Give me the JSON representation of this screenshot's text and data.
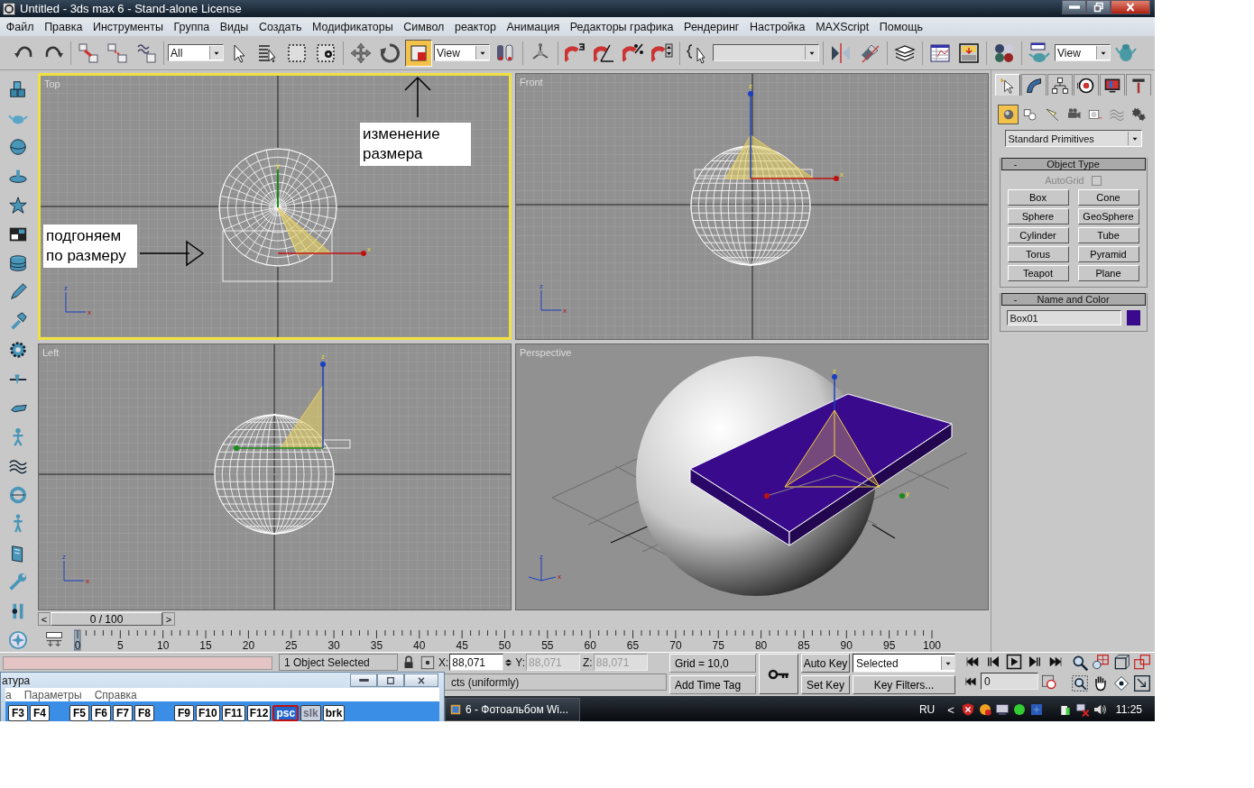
{
  "window": {
    "title": "Untitled - 3ds max 6 - Stand-alone License"
  },
  "menu": [
    "Файл",
    "Правка",
    "Инструменты",
    "Группа",
    "Виды",
    "Создать",
    "Модификаторы",
    "Символ",
    "реактор",
    "Анимация",
    "Редакторы графика",
    "Рендеринг",
    "Настройка",
    "MAXScript",
    "Помощь"
  ],
  "toolbar": [
    [
      {
        "kind": "button",
        "selected": false
      },
      {
        "kind": "button",
        "selected": false
      }
    ],
    [
      {
        "kind": "button",
        "selected": false
      },
      {
        "kind": "button",
        "selected": false
      },
      {
        "kind": "button",
        "selected": false
      }
    ],
    [
      {
        "kind": "dropdown",
        "value": "All"
      },
      {
        "kind": "button",
        "selected": false
      },
      {
        "kind": "button",
        "selected": false
      },
      {
        "kind": "button",
        "selected": false
      },
      {
        "kind": "button",
        "selected": false
      }
    ],
    [
      {
        "kind": "button",
        "selected": false
      },
      {
        "kind": "button",
        "selected": false
      },
      {
        "kind": "button",
        "selected": true
      },
      {
        "kind": "dropdown",
        "value": "View"
      },
      {
        "kind": "button",
        "selected": false
      }
    ],
    [
      {
        "kind": "button",
        "selected": false
      }
    ],
    [
      {
        "kind": "button",
        "selected": false
      },
      {
        "kind": "button",
        "selected": false
      },
      {
        "kind": "button",
        "selected": false
      },
      {
        "kind": "button",
        "selected": false
      }
    ],
    [
      {
        "kind": "button",
        "selected": false
      },
      {
        "kind": "dropdown"
      }
    ],
    [
      {
        "kind": "button",
        "selected": false
      },
      {
        "kind": "button",
        "selected": false
      }
    ],
    [
      {
        "kind": "button",
        "selected": false
      }
    ],
    [
      {
        "kind": "button",
        "selected": false
      },
      {
        "kind": "button",
        "selected": false
      }
    ],
    [
      {
        "kind": "button",
        "selected": false
      }
    ],
    [
      {
        "kind": "button",
        "selected": false
      },
      {
        "kind": "dropdown",
        "value": "View"
      },
      {
        "kind": "button",
        "selected": false
      }
    ]
  ],
  "viewports": [
    {
      "kind": "top",
      "label": "Top",
      "active": true,
      "tripod": [
        "z",
        "x"
      ],
      "gizmo": [
        "y",
        "x"
      ],
      "annotations": [
        "подгоняем по размеру",
        "изменение размера"
      ]
    },
    {
      "kind": "front",
      "label": "Front",
      "active": false,
      "tripod": [
        "z",
        "x"
      ],
      "gizmo": [
        "z",
        "x"
      ]
    },
    {
      "kind": "left",
      "label": "Left",
      "active": false,
      "tripod": [
        "z",
        "x"
      ],
      "gizmo": [
        "z"
      ]
    },
    {
      "kind": "perspective",
      "label": "Perspective",
      "active": false,
      "tripod": [
        "z",
        "x"
      ],
      "gizmo": [
        "z",
        "y"
      ]
    }
  ],
  "command_panel": {
    "tabs": [
      {
        "selected": true
      },
      {
        "selected": false
      },
      {
        "selected": false
      },
      {
        "selected": false
      },
      {
        "selected": false
      },
      {
        "selected": false
      }
    ],
    "categories": [
      {
        "selected": true
      },
      {
        "selected": false
      },
      {
        "selected": false
      },
      {
        "selected": false
      },
      {
        "selected": false
      },
      {
        "selected": false
      },
      {
        "selected": false
      }
    ],
    "dropdown": "Standard Primitives",
    "object_type": {
      "sign": "-",
      "title": "Object Type",
      "autogrid": {
        "label": "AutoGrid",
        "checked": false,
        "disabled": true
      },
      "buttons": [
        "Box",
        "Cone",
        "Sphere",
        "GeoSphere",
        "Cylinder",
        "Tube",
        "Torus",
        "Pyramid",
        "Teapot",
        "Plane"
      ]
    },
    "name_and_color": {
      "sign": "-",
      "title": "Name and Color",
      "name": "Box01",
      "color": "#3a0a8c"
    }
  },
  "time_slider": {
    "prev": "<",
    "label": "0 / 100",
    "next": ">"
  },
  "track_bar": {
    "ticks": [
      "0",
      "5",
      "10",
      "15",
      "20",
      "25",
      "30",
      "35",
      "40",
      "45",
      "50",
      "55",
      "60",
      "65",
      "70",
      "75",
      "80",
      "85",
      "90",
      "95",
      "100"
    ]
  },
  "status": {
    "selection": "1 Object Selected",
    "prompt": "cts (uniformly)",
    "coords": [
      {
        "label": "X:",
        "value": "88,071",
        "disabled": false
      },
      {
        "label": "Y:",
        "value": "88,071",
        "disabled": true
      },
      {
        "label": "Z:",
        "value": "88,071",
        "disabled": true
      }
    ],
    "grid": "Grid = 10,0",
    "time_tag": "Add Time Tag",
    "auto_key": "Auto Key",
    "set_key": "Set Key",
    "key_mode": "Selected",
    "key_filters": "Key Filters...",
    "frame": "0"
  },
  "taskbar": {
    "tasks": [
      "6 - Фотоальбом Wi..."
    ],
    "language": "RU",
    "tray_expand": "<",
    "clock": "11:25"
  },
  "keyboard": {
    "title": "атура",
    "menu": [
      "а",
      "Параметры",
      "Справка"
    ],
    "key_groups": [
      [
        {
          "label": "F3",
          "kind": "normal"
        },
        {
          "label": "F4",
          "kind": "normal"
        }
      ],
      [
        {
          "label": "F5",
          "kind": "normal"
        },
        {
          "label": "F6",
          "kind": "normal"
        },
        {
          "label": "F7",
          "kind": "normal"
        },
        {
          "label": "F8",
          "kind": "normal"
        }
      ],
      [
        {
          "label": "F9",
          "kind": "normal"
        },
        {
          "label": "F10",
          "kind": "normal"
        },
        {
          "label": "F11",
          "kind": "normal"
        },
        {
          "label": "F12",
          "kind": "normal"
        },
        {
          "label": "psc",
          "kind": "pressed"
        },
        {
          "label": "slk",
          "kind": "dim"
        },
        {
          "label": "brk",
          "kind": "normal"
        }
      ]
    ]
  }
}
